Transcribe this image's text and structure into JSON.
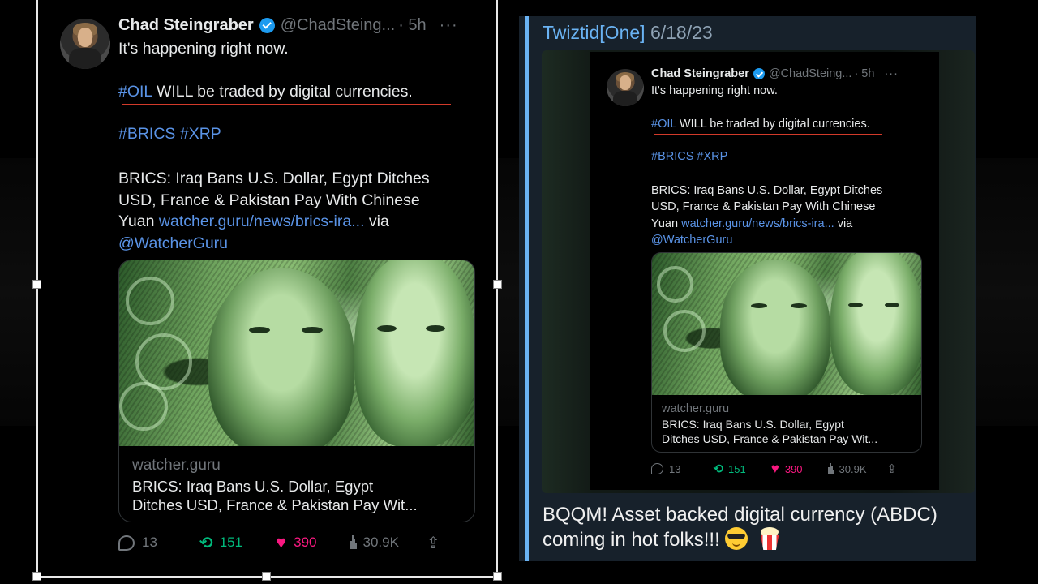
{
  "left_tweet": {
    "author": {
      "name": "Chad Steingraber",
      "handle": "@ChadSteing...",
      "time": "· 5h"
    },
    "more_glyph": "···",
    "line1": "It's happening right now.",
    "line2_tag": "#OIL",
    "line2_rest": " WILL be traded by digital currencies.",
    "tags": "#BRICS #XRP",
    "body": {
      "line1": "BRICS: Iraq Bans U.S. Dollar, Egypt Ditches",
      "line2": "USD, France & Pakistan Pay With Chinese",
      "line3_text": "Yuan ",
      "line3_link": "watcher.guru/news/brics-ira...",
      "line3_via": " via",
      "mention": "@WatcherGuru"
    },
    "card": {
      "domain": "watcher.guru",
      "title_line1": "BRICS: Iraq Bans U.S. Dollar, Egypt",
      "title_line2": "Ditches USD, France & Pakistan Pay Wit..."
    },
    "actions": {
      "replies": "13",
      "retweets": "151",
      "likes": "390",
      "views": "30.9K"
    }
  },
  "right_message": {
    "author": "Twiztid[One]",
    "date": "6/18/23",
    "caption_line1": "BQQM! Asset backed digital currency (ABDC)",
    "caption_line2": "coming in hot folks!!! ",
    "emojis": [
      "sunglasses-face",
      "popcorn"
    ]
  },
  "colors": {
    "accent_blue": "#6ab3f3",
    "link_blue": "#5a93e6",
    "retweet_green": "#00ba7c",
    "like_pink": "#f91880",
    "underline_red": "#d23a2a",
    "panel_bg": "#17212b"
  }
}
